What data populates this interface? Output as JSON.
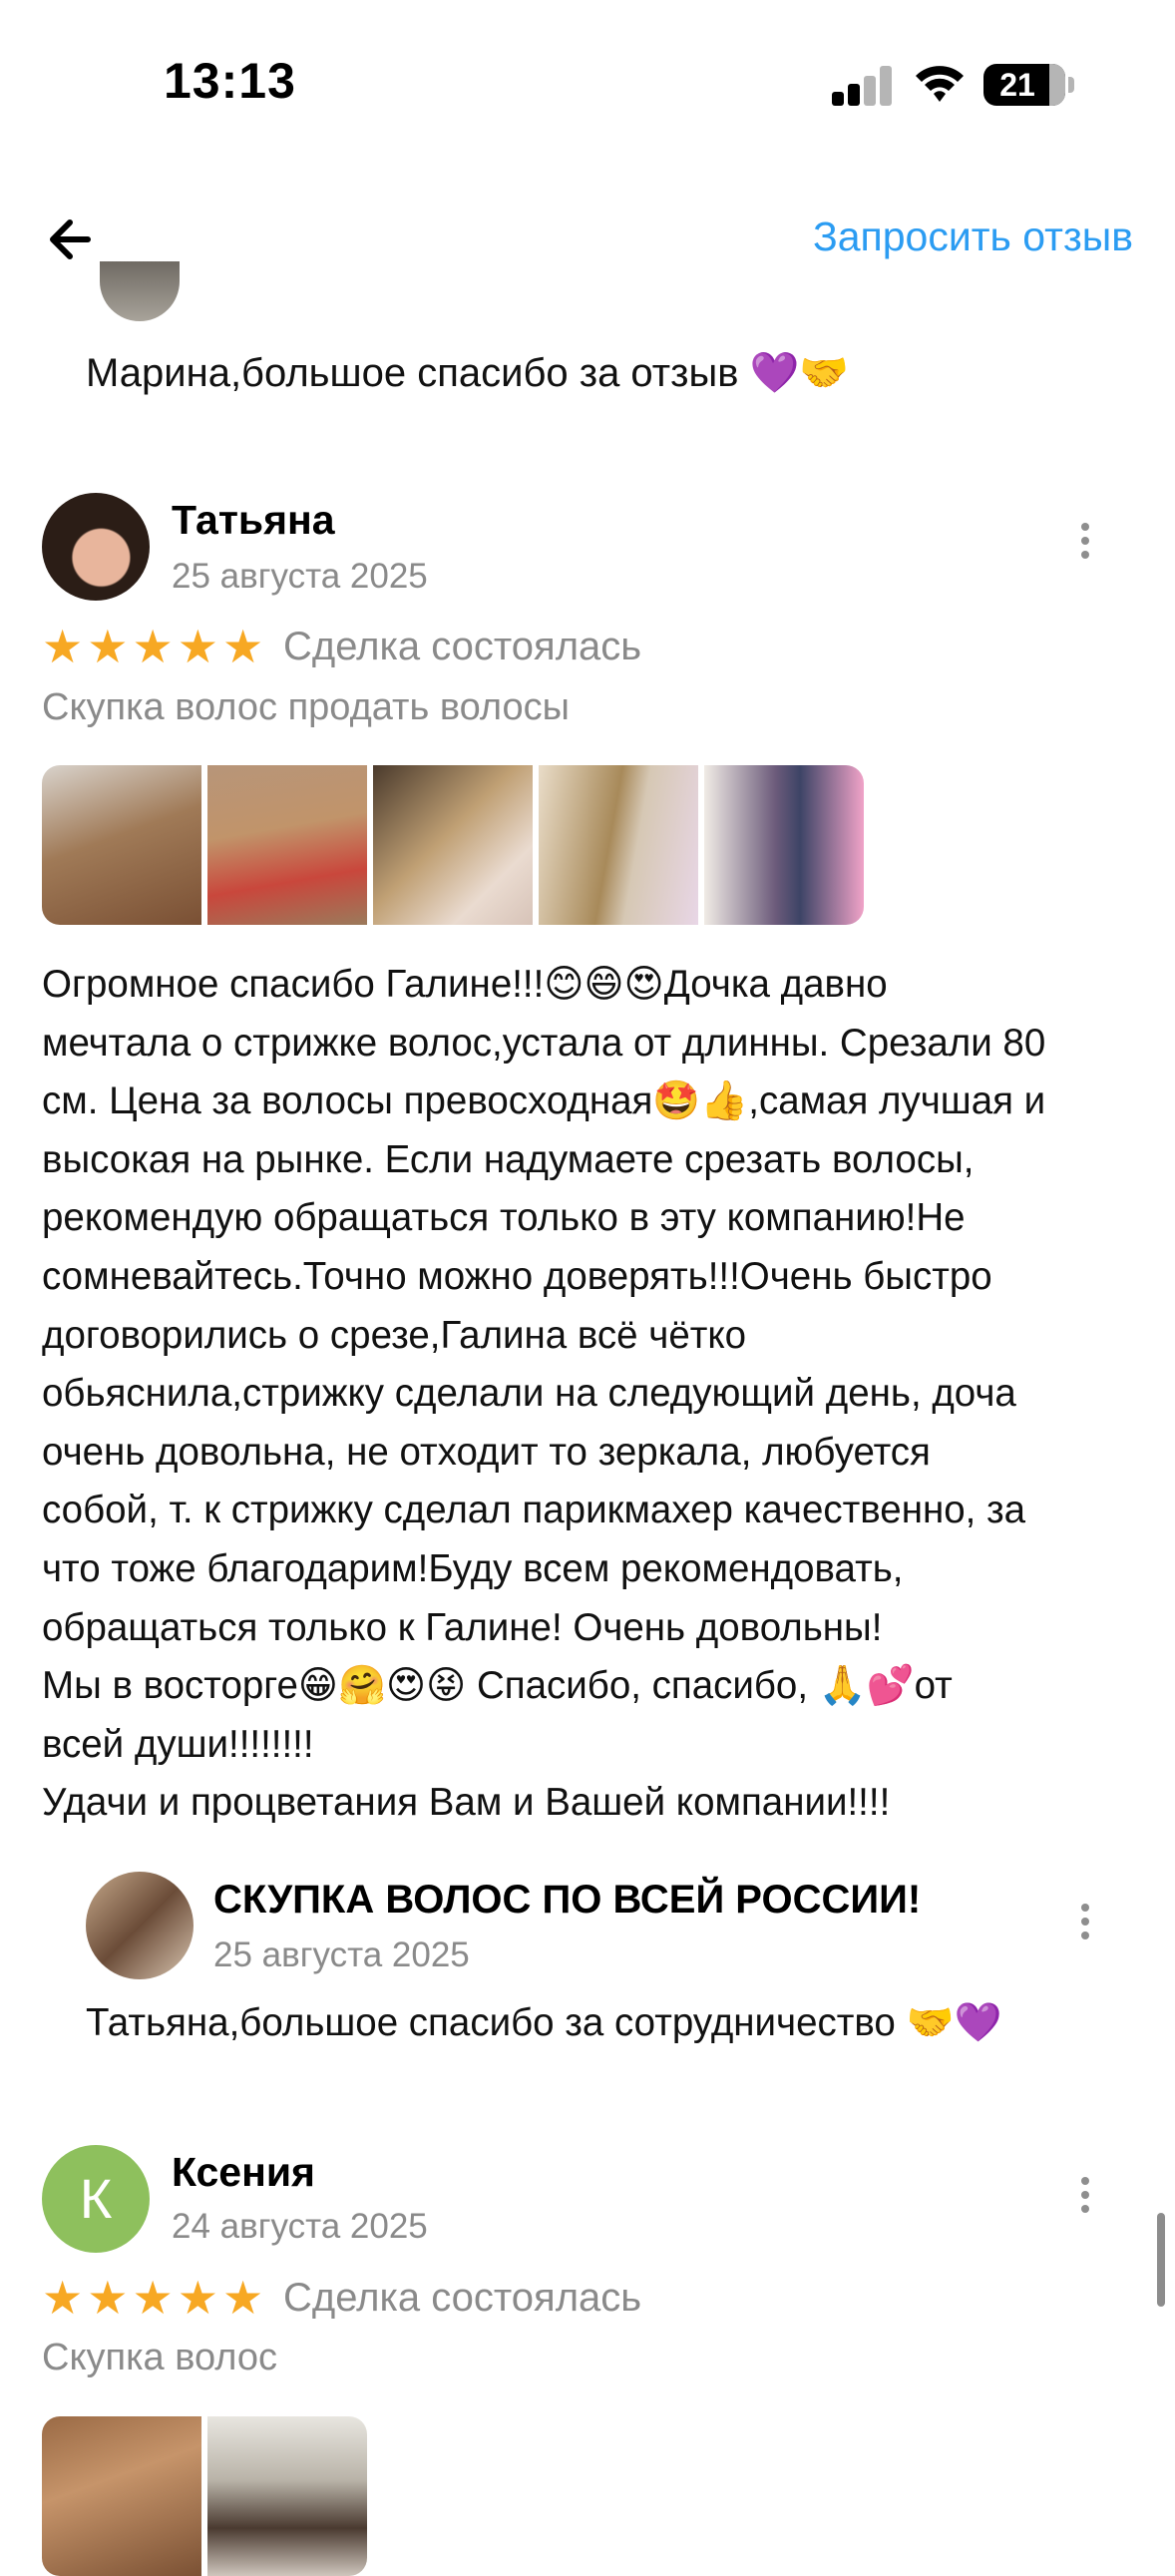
{
  "status_bar": {
    "time": "13:13",
    "battery": "21"
  },
  "nav": {
    "back_icon": "arrow-left-icon",
    "action_label": "Запросить отзыв"
  },
  "previous_reply": {
    "text": "Марина,большое спасибо за отзыв 💜🤝"
  },
  "reviews": [
    {
      "author": "Татьяна",
      "date": "25 августа 2025",
      "rating": 5,
      "deal_status": "Сделка состоялась",
      "service": "Скупка волос продать волосы",
      "photo_count": 5,
      "text": "Огромное спасибо Галине!!!😊😄😍Дочка давно\nмечтала о стрижке волос,устала от длинны. Срезали 80\nсм. Цена за волосы превосходная🤩👍,самая лучшая и\nвысокая на рынке. Если надумаете срезать волосы,\nрекомендую обращаться только в эту компанию!Не\nсомневайтесь.Точно можно доверять!!!Очень быстро\nдоговорились о срезе,Галина всё чётко\nобьяснила,стрижку сделали на следующий день, доча\nочень довольна, не отходит то зеркала, любуется\nсобой, т. к стрижку сделал парикмахер качественно, за\nчто тоже благодарим!Буду всем рекомендовать,\nобращаться только к Галине! Очень довольны!\nМы в восторге😁🤗😍😝 Спасибо, спасибо, 🙏💕от\nвсей души!!!!!!!!\nУдачи и процветания Вам и Вашей компании!!!!",
      "reply": {
        "author": "СКУПКА ВОЛОС ПО ВСЕЙ РОССИИ!",
        "date": "25 августа 2025",
        "text": "Татьяна,большое спасибо за сотрудничество 🤝💜"
      }
    },
    {
      "author": "Ксения",
      "avatar_letter": "К",
      "date": "24 августа 2025",
      "rating": 5,
      "deal_status": "Сделка состоялась",
      "service": "Скупка волос",
      "photo_count": 2
    }
  ],
  "colors": {
    "accent": "#2b9cf2",
    "star": "#f7a823",
    "secondary_text": "#8a8a8a",
    "avatar_k": "#8ec05d"
  }
}
